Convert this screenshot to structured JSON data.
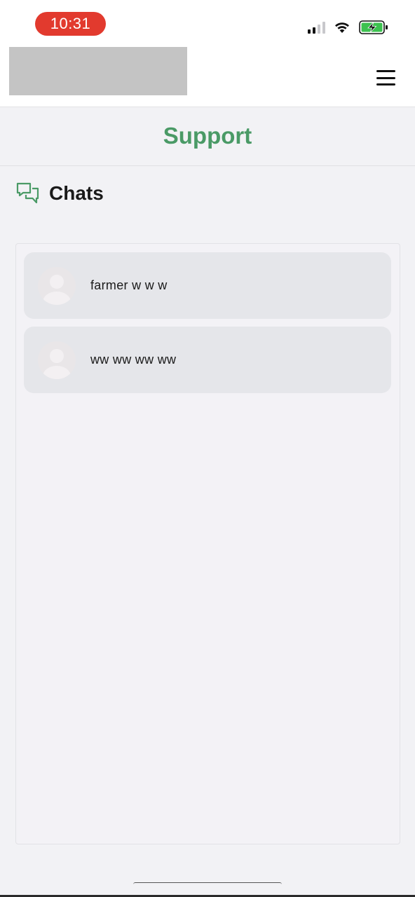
{
  "status_bar": {
    "time": "10:31",
    "icons": [
      "cellular-signal-icon",
      "wifi-icon",
      "battery-charging-icon"
    ],
    "time_pill_color": "#e23a2e"
  },
  "header": {
    "menu_icon": "hamburger-menu-icon"
  },
  "page": {
    "title": "Support",
    "title_color": "#4a9a66"
  },
  "section": {
    "icon": "chat-bubbles-icon",
    "label": "Chats"
  },
  "chats": [
    {
      "name": "farmer w w w",
      "avatar": "default-avatar-icon"
    },
    {
      "name": "ww ww ww ww",
      "avatar": "default-avatar-icon"
    }
  ]
}
